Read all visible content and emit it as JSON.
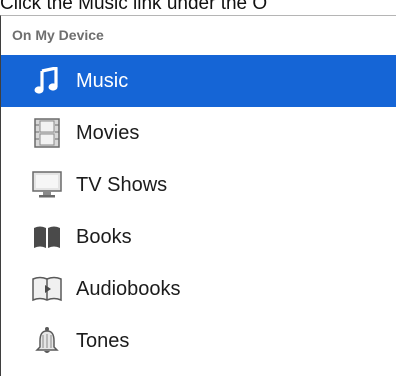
{
  "caption": "Click the Music link under the O",
  "sidebar": {
    "header": "On My Device",
    "selected_bg": "#1565d6",
    "items": [
      {
        "label": "Music",
        "icon": "music-note-icon",
        "selected": true
      },
      {
        "label": "Movies",
        "icon": "film-icon",
        "selected": false
      },
      {
        "label": "TV Shows",
        "icon": "tv-icon",
        "selected": false
      },
      {
        "label": "Books",
        "icon": "book-icon",
        "selected": false
      },
      {
        "label": "Audiobooks",
        "icon": "audiobook-icon",
        "selected": false
      },
      {
        "label": "Tones",
        "icon": "bell-icon",
        "selected": false
      }
    ]
  }
}
